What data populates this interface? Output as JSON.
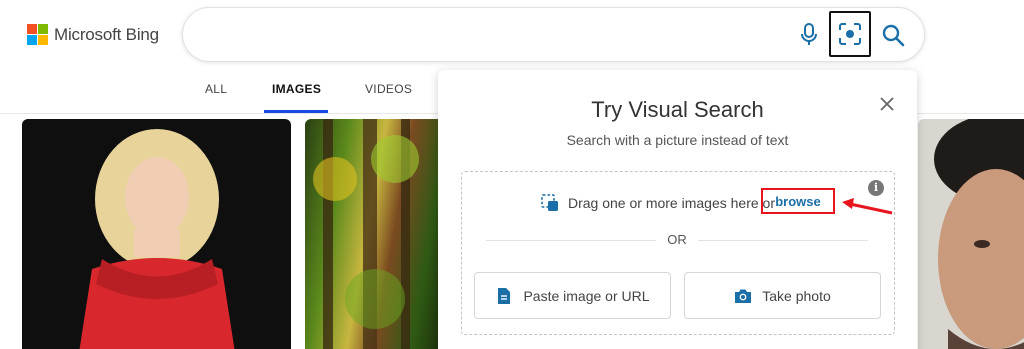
{
  "header": {
    "brand": "Microsoft Bing",
    "logo_colors": [
      "#f25022",
      "#7fba00",
      "#00a4ef",
      "#ffb900"
    ],
    "search": {
      "value": "",
      "placeholder": ""
    },
    "icons": {
      "mic": "microphone-icon",
      "visual": "visual-search-icon",
      "search": "search-icon"
    }
  },
  "tabs": [
    {
      "label": "ALL",
      "active": false
    },
    {
      "label": "IMAGES",
      "active": true
    },
    {
      "label": "VIDEOS",
      "active": false
    }
  ],
  "panel": {
    "title": "Try Visual Search",
    "subtitle": "Search with a picture instead of text",
    "drag_text": "Drag one or more images here or",
    "browse_label": "browse",
    "or_label": "OR",
    "paste_label": "Paste image or URL",
    "photo_label": "Take photo",
    "info_glyph": "i"
  },
  "colors": {
    "accent_blue": "#174ae4",
    "icon_teal": "#1a6fa8",
    "highlight_red": "#e8141e"
  }
}
